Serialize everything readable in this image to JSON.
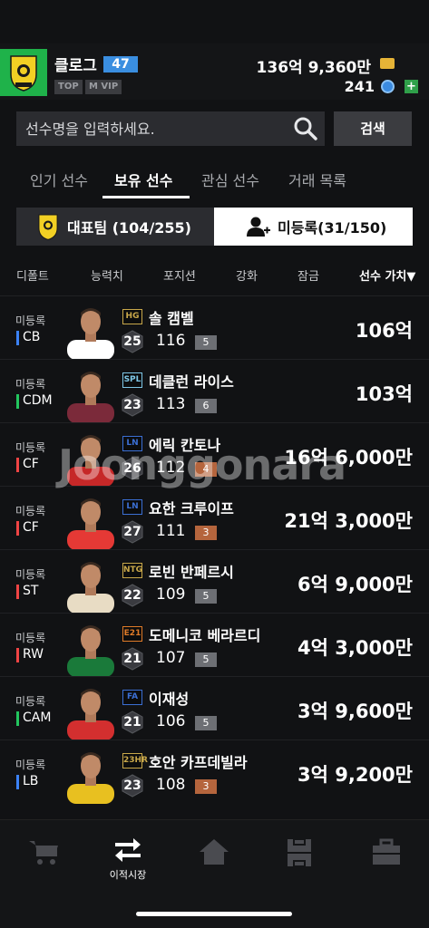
{
  "header": {
    "username": "클로그",
    "level": "47",
    "tag_top": "TOP",
    "tag_vip": "M VIP",
    "money": "136억 9,360만",
    "coins": "241",
    "plus": "+"
  },
  "search": {
    "placeholder": "선수명을 입력하세요.",
    "button": "검색"
  },
  "tabs": [
    "인기 선수",
    "보유 선수",
    "관심 선수",
    "거래 목록"
  ],
  "segment": {
    "squad_label": "대표팀 (104/255)",
    "unregistered_label": "미등록(31/150)"
  },
  "sort": [
    "디폴트",
    "능력치",
    "포지션",
    "강화",
    "잠금",
    "선수 가치▼"
  ],
  "players": [
    {
      "status": "미등록",
      "pos": "CB",
      "posColor": "#3b82f6",
      "season": "HG",
      "seasonColor": "#c9a84a",
      "name": "솔 캠벨",
      "ovr_badge": "25",
      "ovr": "116",
      "grade": "5",
      "gradeColor": "#6d6f74",
      "value": "106억",
      "kit": "#ffffff"
    },
    {
      "status": "미등록",
      "pos": "CDM",
      "posColor": "#22c55e",
      "season": "SPL",
      "seasonColor": "#7fc8e8",
      "name": "데클런 라이스",
      "ovr_badge": "23",
      "ovr": "113",
      "grade": "6",
      "gradeColor": "#6d6f74",
      "value": "103억",
      "kit": "#7b2a3a"
    },
    {
      "status": "미등록",
      "pos": "CF",
      "posColor": "#ef4444",
      "season": "LN",
      "seasonColor": "#3b6fd4",
      "name": "에릭 칸토나",
      "ovr_badge": "26",
      "ovr": "112",
      "grade": "4",
      "gradeColor": "#b5653d",
      "value": "16억 6,000만",
      "kit": "#c62828"
    },
    {
      "status": "미등록",
      "pos": "CF",
      "posColor": "#ef4444",
      "season": "LN",
      "seasonColor": "#3b6fd4",
      "name": "요한 크루이프",
      "ovr_badge": "27",
      "ovr": "111",
      "grade": "3",
      "gradeColor": "#b5653d",
      "value": "21억 3,000만",
      "kit": "#e53935"
    },
    {
      "status": "미등록",
      "pos": "ST",
      "posColor": "#ef4444",
      "season": "NTG",
      "seasonColor": "#c9a84a",
      "name": "로빈 반페르시",
      "ovr_badge": "22",
      "ovr": "109",
      "grade": "5",
      "gradeColor": "#6d6f74",
      "value": "6억 9,000만",
      "kit": "#e8dcc4"
    },
    {
      "status": "미등록",
      "pos": "RW",
      "posColor": "#ef4444",
      "season": "E21",
      "seasonColor": "#e07b28",
      "name": "도메니코 베라르디",
      "ovr_badge": "21",
      "ovr": "107",
      "grade": "5",
      "gradeColor": "#6d6f74",
      "value": "4억 3,000만",
      "kit": "#1a7a3a"
    },
    {
      "status": "미등록",
      "pos": "CAM",
      "posColor": "#22c55e",
      "season": "FA",
      "seasonColor": "#3b6fd4",
      "name": "이재성",
      "ovr_badge": "21",
      "ovr": "106",
      "grade": "5",
      "gradeColor": "#6d6f74",
      "value": "3억 9,600만",
      "kit": "#d32f2f"
    },
    {
      "status": "미등록",
      "pos": "LB",
      "posColor": "#3b82f6",
      "season": "23HR",
      "seasonColor": "#c9a84a",
      "name": "호안 카프데빌라",
      "ovr_badge": "23",
      "ovr": "108",
      "grade": "3",
      "gradeColor": "#b5653d",
      "value": "3억 9,200만",
      "kit": "#e8c020"
    }
  ],
  "watermark": "Joonggonara",
  "nav": {
    "transfer_label": "이적시장"
  },
  "colors": {
    "background": "#111214",
    "accent_blue": "#3a8ee0",
    "club_green": "#1fb24a"
  }
}
